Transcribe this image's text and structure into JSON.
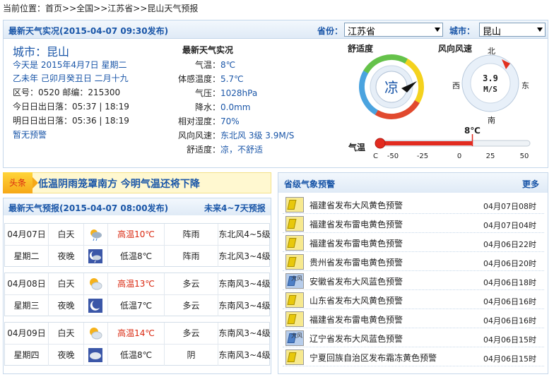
{
  "breadcrumb": {
    "label": "当前位置：",
    "home": "首页",
    "sep1": ">>",
    "country": "全国",
    "sep2": ">>",
    "province": "江苏省",
    "sep3": ">>",
    "current": "昆山天气预报"
  },
  "realtime": {
    "header": "最新天气实况(2015-04-07 09:30发布)",
    "province_label": "省份：",
    "province_value": "江苏省",
    "city_label": "城市：",
    "city_value": "昆山",
    "city_title": "城市：昆山",
    "info": [
      "今天是 2015年4月7日 星期二",
      "乙未年 己卯月癸丑日 二月十九",
      "区号：0520  邮编：215300",
      "今日日出日落：05:37 | 18:19",
      "明日日出日落：05:36 | 18:19",
      "暂无预警"
    ],
    "obs_title": "最新天气实况",
    "obs": [
      {
        "k": "气温：",
        "v": "8℃"
      },
      {
        "k": "体感温度：",
        "v": "5.7℃"
      },
      {
        "k": "气压：",
        "v": "1028hPa"
      },
      {
        "k": "降水：",
        "v": "0.0mm"
      },
      {
        "k": "相对湿度：",
        "v": "70%"
      },
      {
        "k": "风向风速：",
        "v": "东北风 3级 3.9M/S"
      },
      {
        "k": "舒适度：",
        "v": "凉，不舒适"
      }
    ],
    "comfort_label": "舒适度",
    "comfort_value": "凉",
    "wind_label": "风向风速",
    "wind_value": "3.9",
    "wind_unit": "M/S",
    "compass": {
      "n": "北",
      "s": "南",
      "e": "东",
      "w": "西"
    },
    "temp_label": "气温",
    "temp_value": "8℃",
    "temp_unit": "C",
    "temp_ticks": [
      "-50",
      "-25",
      "0",
      "25",
      "50"
    ],
    "temp_reading": 8,
    "temp_min": -50,
    "temp_max": 50
  },
  "headline": {
    "tag": "头条",
    "text": "低温阴雨笼罩南方 今明气温还将下降"
  },
  "forecast": {
    "header": "最新天气预报(2015-04-07 08:00发布)",
    "more": "未来4~7天预报",
    "days": [
      {
        "date": "04月07日",
        "week": "星期二",
        "day": {
          "label": "白天",
          "icon": "rain-day-icon",
          "temp": "高温10℃",
          "weather": "阵雨",
          "wind": "东北风4~5级"
        },
        "night": {
          "label": "夜晚",
          "icon": "rain-night-icon",
          "temp": "低温8℃",
          "weather": "阵雨",
          "wind": "东北风3~4级"
        }
      },
      {
        "date": "04月08日",
        "week": "星期三",
        "day": {
          "label": "白天",
          "icon": "partly-cloudy-day-icon",
          "temp": "高温13℃",
          "weather": "多云",
          "wind": "东南风3~4级"
        },
        "night": {
          "label": "夜晚",
          "icon": "partly-cloudy-night-icon",
          "temp": "低温7℃",
          "weather": "多云",
          "wind": "东南风3~4级"
        }
      },
      {
        "date": "04月09日",
        "week": "星期四",
        "day": {
          "label": "白天",
          "icon": "partly-cloudy-day-icon",
          "temp": "高温14℃",
          "weather": "多云",
          "wind": "东南风3~4级"
        },
        "night": {
          "label": "夜晚",
          "icon": "cloudy-icon",
          "temp": "低温8℃",
          "weather": "阴",
          "wind": "东南风3~4级"
        }
      }
    ]
  },
  "alerts": {
    "header": "省级气象预警",
    "more": "更多",
    "items": [
      {
        "text": "福建省发布大风黄色预警",
        "time": "04月07日08时",
        "level": "yellow",
        "icon_text": ""
      },
      {
        "text": "福建省发布雷电黄色预警",
        "time": "04月07日04时",
        "level": "yellow",
        "icon_text": ""
      },
      {
        "text": "福建省发布雷电黄色预警",
        "time": "04月06日22时",
        "level": "yellow",
        "icon_text": ""
      },
      {
        "text": "贵州省发布雷电黄色预警",
        "time": "04月06日20时",
        "level": "yellow",
        "icon_text": ""
      },
      {
        "text": "安徽省发布大风蓝色预警",
        "time": "04月06日18时",
        "level": "blue",
        "icon_text": "大风"
      },
      {
        "text": "山东省发布大风黄色预警",
        "time": "04月06日16时",
        "level": "yellow",
        "icon_text": ""
      },
      {
        "text": "福建省发布雷电黄色预警",
        "time": "04月06日16时",
        "level": "yellow",
        "icon_text": ""
      },
      {
        "text": "辽宁省发布大风蓝色预警",
        "time": "04月06日15时",
        "level": "blue",
        "icon_text": "大风"
      },
      {
        "text": "宁夏回族自治区发布霜冻黄色预警",
        "time": "04月06日15时",
        "level": "yellow",
        "icon_text": ""
      }
    ]
  }
}
